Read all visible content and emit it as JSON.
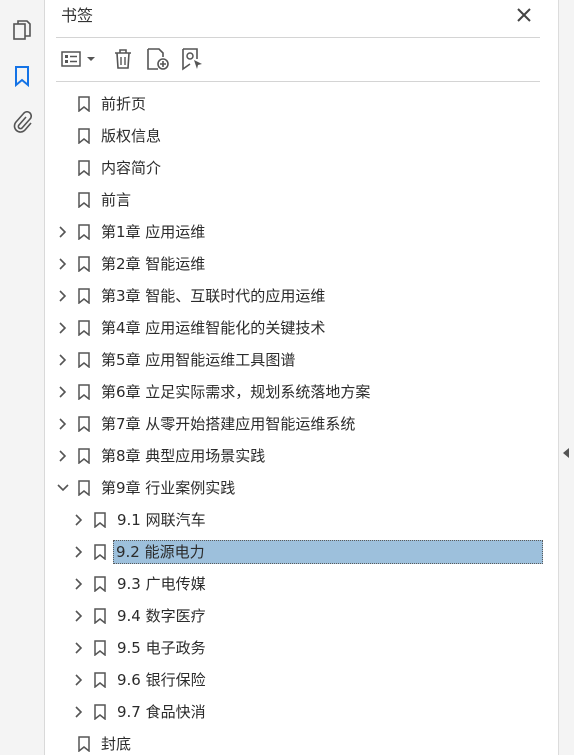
{
  "panel": {
    "title": "书签"
  },
  "sidebar": {
    "icons": [
      "pages-icon",
      "bookmark-icon",
      "attachment-icon"
    ]
  },
  "toolbar": {
    "buttons": [
      "options-menu-icon",
      "delete-bookmark-icon",
      "new-bookmark-icon",
      "bookmark-from-structure-icon"
    ]
  },
  "bookmarks": [
    {
      "label": "前折页"
    },
    {
      "label": "版权信息"
    },
    {
      "label": "内容简介"
    },
    {
      "label": "前言"
    },
    {
      "label": "第1章 应用运维"
    },
    {
      "label": "第2章 智能运维"
    },
    {
      "label": "第3章 智能、互联时代的应用运维"
    },
    {
      "label": "第4章 应用运维智能化的关键技术"
    },
    {
      "label": "第5章 应用智能运维工具图谱"
    },
    {
      "label": "第6章 立足实际需求，规划系统落地方案"
    },
    {
      "label": "第7章 从零开始搭建应用智能运维系统"
    },
    {
      "label": "第8章 典型应用场景实践"
    },
    {
      "label": "第9章 行业案例实践"
    },
    {
      "label": "9.1 网联汽车"
    },
    {
      "label": "9.2 能源电力"
    },
    {
      "label": "9.3 广电传媒"
    },
    {
      "label": "9.4 数字医疗"
    },
    {
      "label": "9.5 电子政务"
    },
    {
      "label": "9.6 银行保险"
    },
    {
      "label": "9.7 食品快消"
    },
    {
      "label": "封底"
    }
  ],
  "selected_bookmark": "9.2 能源电力",
  "colors": {
    "selection": "#9dc0dc",
    "sidebar_active": "#1473e6"
  }
}
